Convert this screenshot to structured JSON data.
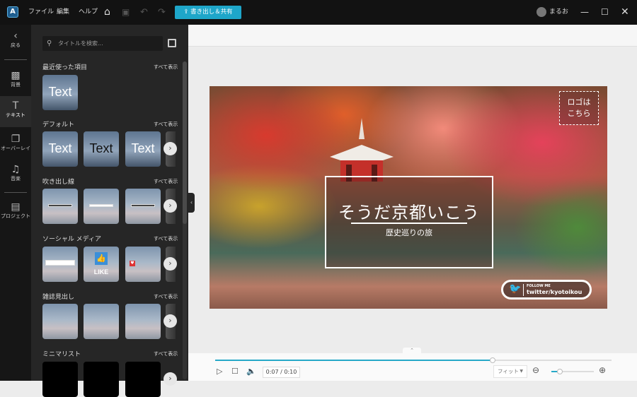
{
  "titlebar": {
    "menu": [
      "ファイル",
      "編集",
      "ヘルプ"
    ],
    "export_label": "書き出し＆共有",
    "user": "まるお",
    "icons": [
      "home-icon",
      "save-icon",
      "undo-icon",
      "redo-icon"
    ]
  },
  "rail": {
    "back": "戻る",
    "items": [
      {
        "label": "背景"
      },
      {
        "label": "テキスト",
        "active": true
      },
      {
        "label": "オーバーレイ"
      },
      {
        "label": "音楽"
      },
      {
        "label": "プロジェクト"
      }
    ]
  },
  "panel": {
    "search_placeholder": "タイトルを検索...",
    "see_all": "すべて表示",
    "sections": [
      {
        "title": "最近使った項目",
        "thumbs": [
          "Text"
        ]
      },
      {
        "title": "デフォルト",
        "thumbs": [
          "Text",
          "Text",
          "Text"
        ]
      },
      {
        "title": "吹き出し線"
      },
      {
        "title": "ソーシャル メディア",
        "like": "LIKE"
      },
      {
        "title": "雑誌見出し"
      },
      {
        "title": "ミニマリスト"
      }
    ]
  },
  "preview": {
    "logo_text": "ロゴは\nこちら",
    "title": "そうだ京都いこう",
    "subtitle": "歴史巡りの旅",
    "follow": "FOLLOW ME",
    "handle": "twitter/kyotoikou"
  },
  "player": {
    "time": "0:07 / 0:10",
    "progress": 0.7,
    "fit": "フィット",
    "zoom": 0.2,
    "accent": "#27a9c8"
  }
}
